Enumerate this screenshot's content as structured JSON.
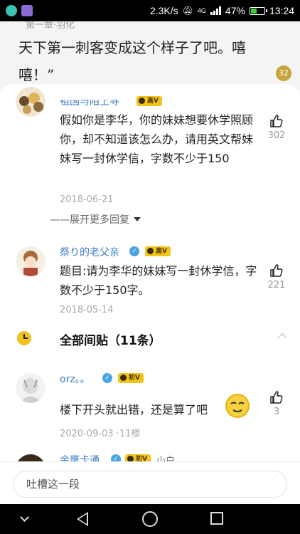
{
  "status_bar": {
    "speed": "2.3K/s",
    "network": "4G",
    "battery": "47%",
    "battery_level": 0.47,
    "time": "13:24"
  },
  "article": {
    "chapter": "第一章·羽化",
    "text": "天下第一刺客变成这个样子了吧。嘻嘻！”",
    "comment_count": "32"
  },
  "comments": [
    {
      "user": "祖国与陌上寻",
      "level": "高V",
      "text": "假如你是李华，你的妹妹想要休学照顾你，却不知道该怎么办，请用英文帮妹妹写一封休学信，字数不少于150",
      "date": "2018-06-21",
      "likes": "302"
    },
    {
      "user": "祭り的老父亲",
      "level": "高V",
      "text": "题目:请为李华的妹妹写一封休学信，字数不少于150字。",
      "date": "2018-05-14",
      "likes": "221"
    }
  ],
  "expand_more": "——展开更多回复",
  "section": {
    "title": "全部间贴（11条）"
  },
  "posts": [
    {
      "user": "orz。。",
      "level": "初V",
      "text": "楼下开头就出错，还是算了吧",
      "date": "2020-09-03 ·11楼",
      "likes": "3"
    },
    {
      "user": "金鹰卡通",
      "level": "初V",
      "extra": "小白"
    }
  ],
  "input": {
    "placeholder": "吐槽这一段"
  },
  "colors": {
    "link": "#3d7ec7",
    "badge": "#f0c419",
    "accent": "#f4c21e"
  }
}
